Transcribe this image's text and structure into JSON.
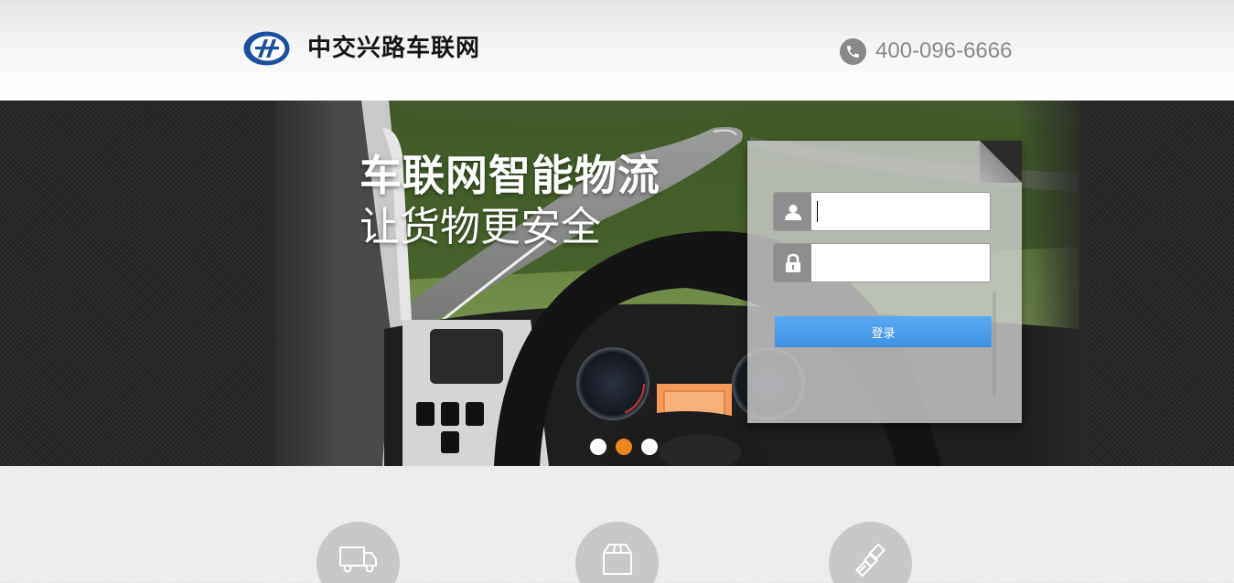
{
  "header": {
    "logo_text": "中交兴路车联网",
    "phone_icon": "phone-icon",
    "phone_number": "400-096-6666"
  },
  "banner": {
    "slogan_line1": "车联网智能物流",
    "slogan_line2": "让货物更安全",
    "carousel": {
      "slide_count": 3,
      "active_index": 1
    }
  },
  "login": {
    "username_icon": "user-icon",
    "password_icon": "lock-icon",
    "username_value": "",
    "password_value": "",
    "submit_label": "登录"
  },
  "features": {
    "icons": [
      "truck-icon",
      "package-icon",
      "satellite-icon"
    ]
  },
  "colors": {
    "brand_blue": "#1a4fa0",
    "button_blue": "#4a9be8",
    "active_dot": "#f08519",
    "phone_gray": "#8a8a8a"
  }
}
